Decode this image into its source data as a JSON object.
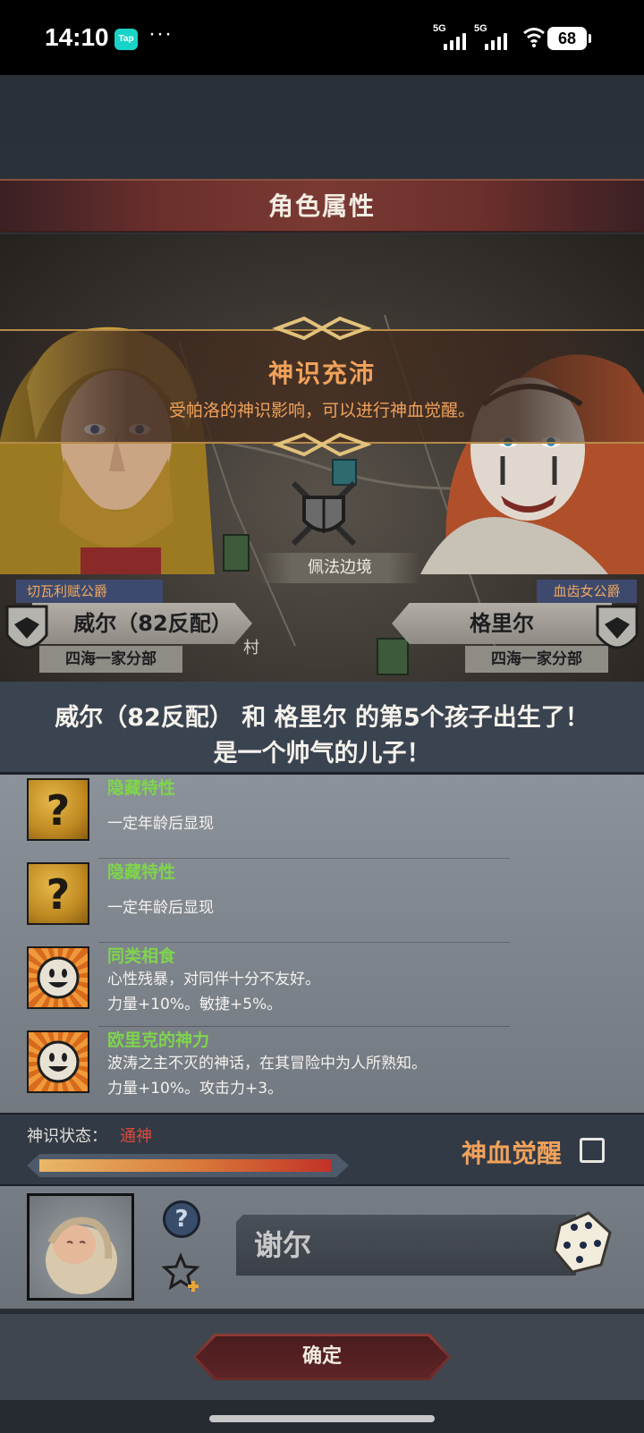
{
  "status_bar": {
    "time": "14:10",
    "app_badge": "Tap",
    "more": "···",
    "network1": "5G",
    "network2": "5G",
    "battery": "68"
  },
  "screen": {
    "title": "角色属性"
  },
  "banner": {
    "title": "神识充沛",
    "subtitle": "受帕洛的神识影响，可以进行神血觉醒。"
  },
  "scene": {
    "location": "佩法边境",
    "map_label": "村",
    "father": {
      "title": "切瓦利赋公爵",
      "name": "威尔（82反配）",
      "house": "四海一家分部"
    },
    "mother": {
      "title": "血齿女公爵",
      "name": "格里尔",
      "house": "四海一家分部"
    }
  },
  "announcement": {
    "line1": "威尔（82反配） 和 格里尔 的第5个孩子出生了！",
    "line2": "是一个帅气的儿子！"
  },
  "traits": [
    {
      "icon": "hidden-trait-icon",
      "name": "隐藏特性",
      "desc1": "",
      "desc2": "一定年龄后显现"
    },
    {
      "icon": "hidden-trait-icon",
      "name": "隐藏特性",
      "desc1": "",
      "desc2": "一定年龄后显现"
    },
    {
      "icon": "smile-trait-icon",
      "name": "同类相食",
      "desc1": "心性残暴，对同伴十分不友好。",
      "desc2": "力量+10%。敏捷+5%。"
    },
    {
      "icon": "smile-trait-icon",
      "name": "欧里克的神力",
      "desc1": "波涛之主不灭的神话，在其冒险中为人所熟知。",
      "desc2": "力量+10%。攻击力+3。"
    }
  ],
  "divine": {
    "label": "神识状态：",
    "value": "通神",
    "progress": 1.0,
    "awaken_label": "神血觉醒",
    "awaken_checked": false
  },
  "child": {
    "name": "谢尔"
  },
  "confirm_label": "确定",
  "colors": {
    "accent_orange": "#f1a25a",
    "trait_green": "#7fd44e",
    "status_red": "#e04a3a",
    "title_bar_red": "#7a3a33"
  }
}
